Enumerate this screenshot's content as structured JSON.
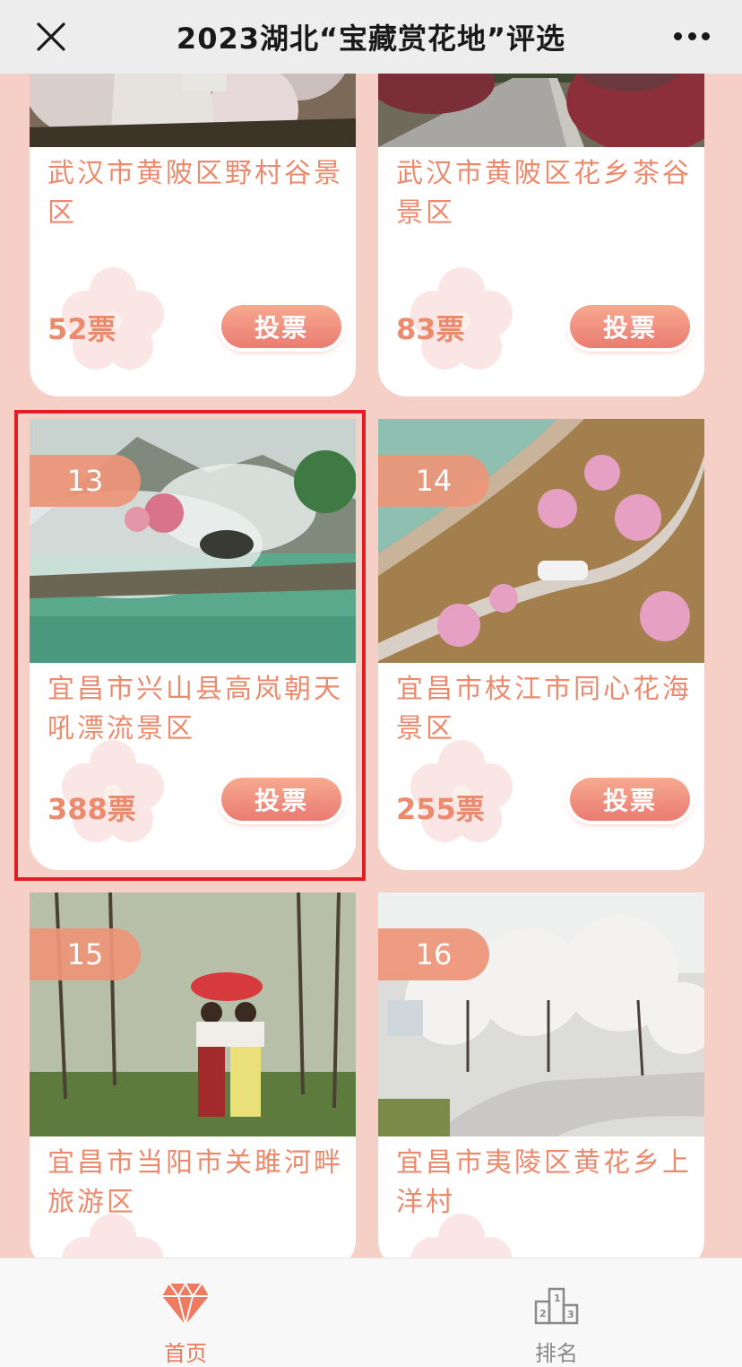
{
  "header": {
    "title": "2023湖北“宝藏赏花地”评选"
  },
  "cards": [
    {
      "rank": "",
      "name": "武汉市黄陂区野村谷景区",
      "votes": "52票",
      "button": "投票"
    },
    {
      "rank": "",
      "name": "武汉市黄陂区花乡茶谷景区",
      "votes": "83票",
      "button": "投票"
    },
    {
      "rank": "13",
      "name": "宜昌市兴山县高岚朝天吼漂流景区",
      "votes": "388票",
      "button": "投票"
    },
    {
      "rank": "14",
      "name": "宜昌市枝江市同心花海景区",
      "votes": "255票",
      "button": "投票"
    },
    {
      "rank": "15",
      "name": "宜昌市当阳市关雎河畔旅游区",
      "votes": "",
      "button": ""
    },
    {
      "rank": "16",
      "name": "宜昌市夷陵区黄花乡上洋村",
      "votes": "",
      "button": ""
    }
  ],
  "tabs": [
    {
      "label": "首页",
      "icon": "diamond-icon",
      "active": true
    },
    {
      "label": "排名",
      "icon": "podium-icon",
      "active": false
    }
  ],
  "colors": {
    "accent": "#ec8a6d",
    "background": "#f6cfc6",
    "highlight": "#e21c22"
  }
}
